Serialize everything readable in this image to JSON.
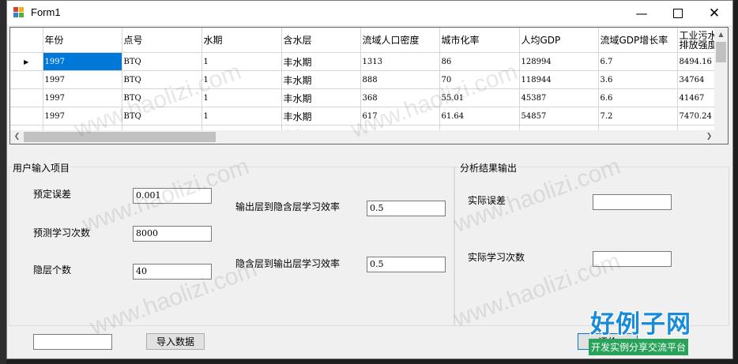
{
  "window": {
    "title": "Form1"
  },
  "grid": {
    "columns": [
      "年份",
      "点号",
      "水期",
      "含水层",
      "流域人口密度",
      "城市化率",
      "人均GDP",
      "流域GDP增长率",
      "工业污水排放强度"
    ],
    "rows": [
      [
        "1997",
        "BTQ",
        "1",
        "丰水期",
        "1313",
        "86",
        "128994",
        "6.7",
        "8494.16"
      ],
      [
        "1997",
        "BTQ",
        "1",
        "丰水期",
        "888",
        "70",
        "118944",
        "3.6",
        "34764"
      ],
      [
        "1997",
        "BTQ",
        "1",
        "丰水期",
        "368",
        "55.01",
        "45387",
        "6.6",
        "41467"
      ],
      [
        "1997",
        "BTQ",
        "1",
        "丰水期",
        "617",
        "61.64",
        "54857",
        "7.2",
        "7470.24"
      ],
      [
        "",
        "",
        "",
        "丰水期",
        "",
        "",
        "",
        "",
        ""
      ]
    ]
  },
  "input_group": {
    "title": "用户输入项目",
    "expected_error_label": "预定误差",
    "expected_error_value": "0.001",
    "planned_iterations_label": "预测学习次数",
    "planned_iterations_value": "8000",
    "hidden_nodes_label": "隐层个数",
    "hidden_nodes_value": "40",
    "out_hidden_rate_label": "输出层到隐含层学习效率",
    "out_hidden_rate_value": "0.5",
    "hidden_out_rate_label": "隐含层到输出层学习效率",
    "hidden_out_rate_value": "0.5"
  },
  "output_group": {
    "title": "分析结果输出",
    "actual_error_label": "实际误差",
    "actual_error_value": "",
    "actual_iterations_label": "实际学习次数",
    "actual_iterations_value": ""
  },
  "footer": {
    "path_value": "",
    "import_label": "导入数据",
    "action_label": "评价"
  },
  "watermark": {
    "text": "www.haolizi.com",
    "logo_title": "好例子网",
    "logo_subtitle": "开发实例分享交流平台"
  }
}
